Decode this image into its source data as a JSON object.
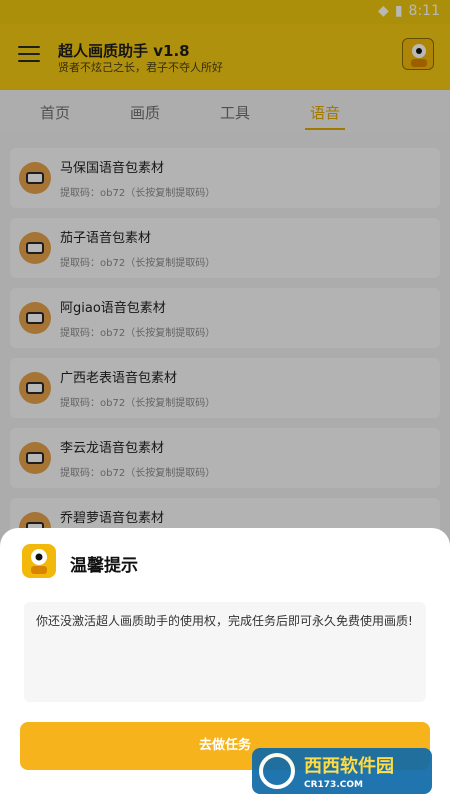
{
  "status_bar": {
    "time": "8:11"
  },
  "app_bar": {
    "title": "超人画质助手 v1.8",
    "subtitle": "贤者不炫己之长，君子不夺人所好"
  },
  "tabs": [
    {
      "label": "首页",
      "active": false
    },
    {
      "label": "画质",
      "active": false
    },
    {
      "label": "工具",
      "active": false
    },
    {
      "label": "语音",
      "active": true
    }
  ],
  "list": [
    {
      "name": "马保国语音包素材",
      "code": "提取码：ob72（长按复制提取码）"
    },
    {
      "name": "茄子语音包素材",
      "code": "提取码：ob72（长按复制提取码）"
    },
    {
      "name": "阿giao语音包素材",
      "code": "提取码：ob72（长按复制提取码）"
    },
    {
      "name": "广西老表语音包素材",
      "code": "提取码：ob72（长按复制提取码）"
    },
    {
      "name": "李云龙语音包素材",
      "code": "提取码：ob72（长按复制提取码）"
    },
    {
      "name": "乔碧萝语音包素材",
      "code": ""
    }
  ],
  "dialog": {
    "title": "温馨提示",
    "message": "你还没激活超人画质助手的使用权，完成任务后即可永久免费使用画质!",
    "button_label": "去做任务"
  },
  "watermark": {
    "brand": "西西软件园",
    "site": "CR173.COM"
  },
  "colors": {
    "primary": "#f4c912",
    "accent": "#e1a800",
    "button": "#f7b31c"
  }
}
